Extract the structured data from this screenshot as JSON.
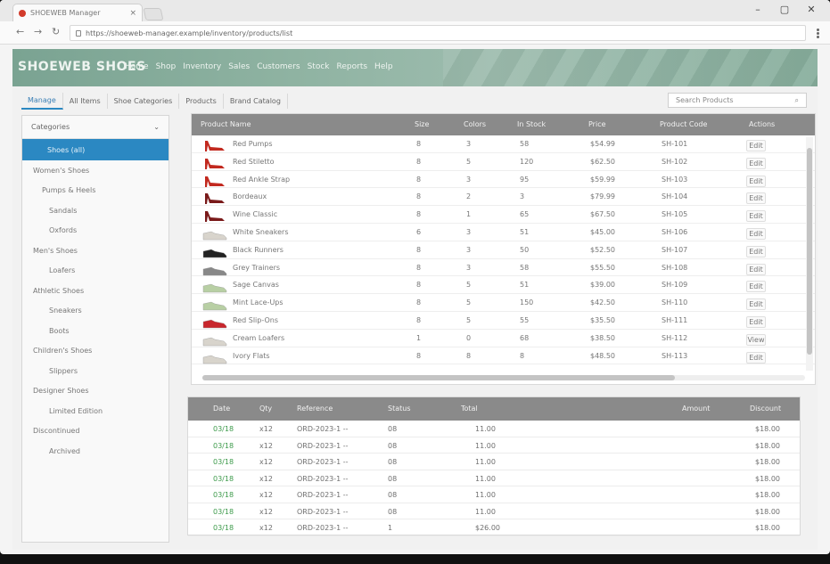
{
  "browser": {
    "tab_title": "SHOEWEB Manager",
    "url": "https://shoeweb-manager.example/inventory/products/list"
  },
  "banner": {
    "brand": "SHOEWEB SHOES",
    "nav": [
      "Home",
      "Shop",
      "Inventory",
      "Sales",
      "Customers",
      "Stock",
      "Reports",
      "Help"
    ]
  },
  "subnav": {
    "tabs": [
      "Manage",
      "All Items",
      "Shoe Categories",
      "Products",
      "Brand Catalog"
    ],
    "search_placeholder": "Search Products"
  },
  "sidebar": {
    "header": "Categories",
    "active": "Shoes (all)",
    "items": [
      {
        "label": "Women's Shoes",
        "level": 0
      },
      {
        "label": "Pumps & Heels",
        "level": 1
      },
      {
        "label": "Sandals",
        "level": 2
      },
      {
        "label": "Oxfords",
        "level": 2
      },
      {
        "label": "Men's Shoes",
        "level": 0
      },
      {
        "label": "Loafers",
        "level": 2
      },
      {
        "label": "Athletic Shoes",
        "level": 0
      },
      {
        "label": "Sneakers",
        "level": 2
      },
      {
        "label": "Boots",
        "level": 2
      },
      {
        "label": "Children's Shoes",
        "level": 0
      },
      {
        "label": "Slippers",
        "level": 2
      },
      {
        "label": "Designer Shoes",
        "level": 0
      },
      {
        "label": "Limited Edition",
        "level": 2
      },
      {
        "label": "Discontinued",
        "level": 0
      },
      {
        "label": "Archived",
        "level": 2
      }
    ]
  },
  "products": {
    "columns": [
      "Product Name",
      "Size",
      "Colors",
      "In Stock",
      "Price",
      "Product Code",
      "Actions"
    ],
    "rows": [
      {
        "thumb": "red-heel",
        "name": "Red Pumps",
        "size": "8",
        "colors": "3",
        "stock": "58",
        "price": "$54.99",
        "code": "SH-101",
        "action": "Edit"
      },
      {
        "thumb": "red-heel",
        "name": "Red Stiletto",
        "size": "8",
        "colors": "5",
        "stock": "120",
        "price": "$62.50",
        "code": "SH-102",
        "action": "Edit"
      },
      {
        "thumb": "red-heel",
        "name": "Red Ankle Strap",
        "size": "8",
        "colors": "3",
        "stock": "95",
        "price": "$59.99",
        "code": "SH-103",
        "action": "Edit"
      },
      {
        "thumb": "dark-red-heel",
        "name": "Bordeaux",
        "size": "8",
        "colors": "2",
        "stock": "3",
        "price": "$79.99",
        "code": "SH-104",
        "action": "Edit"
      },
      {
        "thumb": "dark-red-heel",
        "name": "Wine Classic",
        "size": "8",
        "colors": "1",
        "stock": "65",
        "price": "$67.50",
        "code": "SH-105",
        "action": "Edit"
      },
      {
        "thumb": "white-sneaker",
        "name": "White Sneakers",
        "size": "6",
        "colors": "3",
        "stock": "51",
        "price": "$45.00",
        "code": "SH-106",
        "action": "Edit"
      },
      {
        "thumb": "black-sneaker",
        "name": "Black Runners",
        "size": "8",
        "colors": "3",
        "stock": "50",
        "price": "$52.50",
        "code": "SH-107",
        "action": "Edit"
      },
      {
        "thumb": "grey-sneaker",
        "name": "Grey Trainers",
        "size": "8",
        "colors": "3",
        "stock": "58",
        "price": "$55.50",
        "code": "SH-108",
        "action": "Edit"
      },
      {
        "thumb": "green-sneaker",
        "name": "Sage Canvas",
        "size": "8",
        "colors": "5",
        "stock": "51",
        "price": "$39.00",
        "code": "SH-109",
        "action": "Edit"
      },
      {
        "thumb": "green-sneaker",
        "name": "Mint Lace-Ups",
        "size": "8",
        "colors": "5",
        "stock": "150",
        "price": "$42.50",
        "code": "SH-110",
        "action": "Edit"
      },
      {
        "thumb": "red-sneaker",
        "name": "Red Slip-Ons",
        "size": "8",
        "colors": "5",
        "stock": "55",
        "price": "$35.50",
        "code": "SH-111",
        "action": "Edit"
      },
      {
        "thumb": "white-sneaker",
        "name": "Cream Loafers",
        "size": "1",
        "colors": "0",
        "stock": "68",
        "price": "$38.50",
        "code": "SH-112",
        "action": "View"
      },
      {
        "thumb": "white-sneaker",
        "name": "Ivory Flats",
        "size": "8",
        "colors": "8",
        "stock": "8",
        "price": "$48.50",
        "code": "SH-113",
        "action": "Edit"
      }
    ]
  },
  "orders": {
    "columns": [
      "Date",
      "Qty",
      "Reference",
      "Status",
      "Total",
      "Amount",
      "Discount"
    ],
    "rows": [
      {
        "date": "03/18",
        "qty": "x12",
        "ref": "ORD-2023-1 --",
        "status": "08",
        "total": "11.00",
        "discount": "$18.00"
      },
      {
        "date": "03/18",
        "qty": "x12",
        "ref": "ORD-2023-1 --",
        "status": "08",
        "total": "11.00",
        "discount": "$18.00"
      },
      {
        "date": "03/18",
        "qty": "x12",
        "ref": "ORD-2023-1 --",
        "status": "08",
        "total": "11.00",
        "discount": "$18.00"
      },
      {
        "date": "03/18",
        "qty": "x12",
        "ref": "ORD-2023-1 --",
        "status": "08",
        "total": "11.00",
        "discount": "$18.00"
      },
      {
        "date": "03/18",
        "qty": "x12",
        "ref": "ORD-2023-1 --",
        "status": "08",
        "total": "11.00",
        "discount": "$18.00"
      },
      {
        "date": "03/18",
        "qty": "x12",
        "ref": "ORD-2023-1 --",
        "status": "08",
        "total": "11.00",
        "discount": "$18.00"
      },
      {
        "date": "03/18",
        "qty": "x12",
        "ref": "ORD-2023-1 --",
        "status": "1",
        "total": "$26.00",
        "discount": "$18.00"
      }
    ]
  },
  "colors": {
    "accent": "#2b88c2",
    "banner": "#8fb3a2",
    "header_gray": "#8a8a8a",
    "positive": "#3d9a4b"
  }
}
